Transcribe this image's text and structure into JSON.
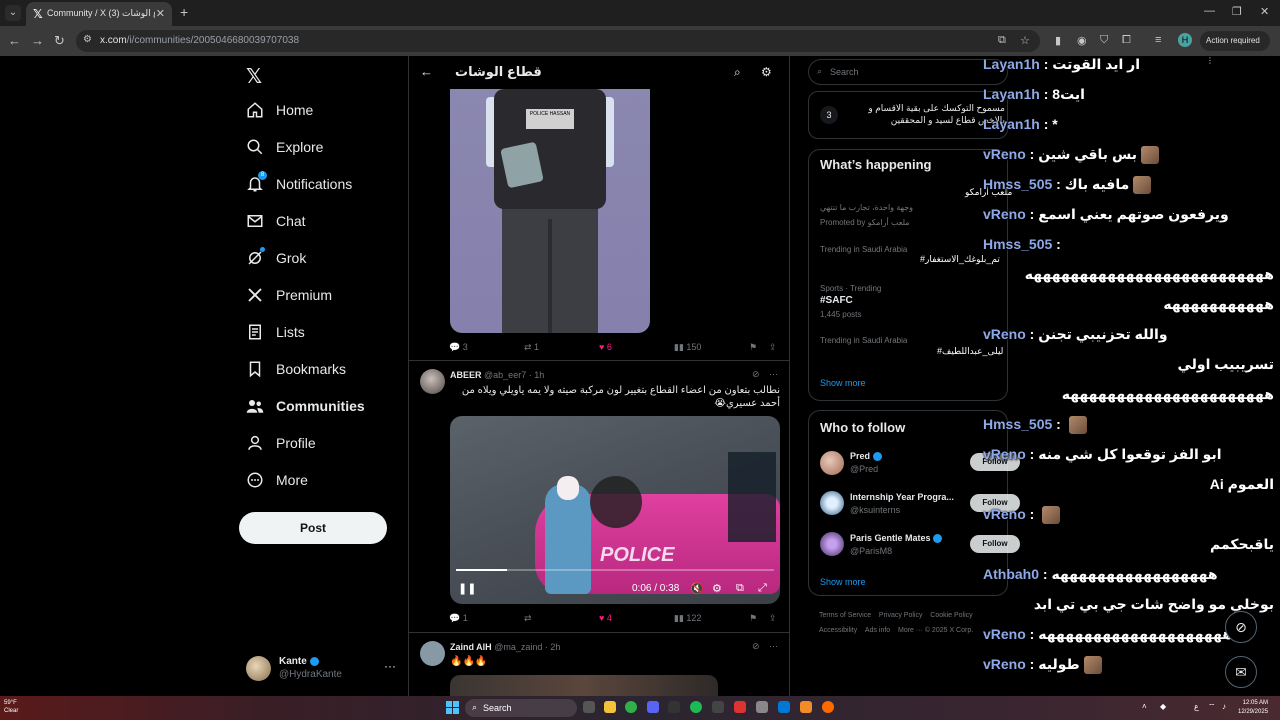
{
  "browser": {
    "tab_title": "Community / X قطاع الوشات (3)",
    "url_host": "x.com",
    "url_path": "/i/communities/2005046680039707038",
    "action_required": "Action required",
    "profile_initial": "H"
  },
  "nav": {
    "items": [
      {
        "label": "Home",
        "icon": "home-icon"
      },
      {
        "label": "Explore",
        "icon": "search-icon"
      },
      {
        "label": "Notifications",
        "icon": "bell-icon",
        "badge": "8"
      },
      {
        "label": "Chat",
        "icon": "mail-icon"
      },
      {
        "label": "Grok",
        "icon": "grok-icon"
      },
      {
        "label": "Premium",
        "icon": "x-icon"
      },
      {
        "label": "Lists",
        "icon": "list-icon"
      },
      {
        "label": "Bookmarks",
        "icon": "bookmark-icon"
      },
      {
        "label": "Communities",
        "icon": "people-icon"
      },
      {
        "label": "Profile",
        "icon": "person-icon"
      },
      {
        "label": "More",
        "icon": "more-circle-icon"
      }
    ],
    "post_label": "Post",
    "account": {
      "name": "Kante",
      "handle": "@HydraKante"
    }
  },
  "timeline": {
    "community_title": "قطاع الوشات",
    "post1": {
      "replies": "3",
      "reposts": "1",
      "likes": "6",
      "views": "150",
      "badge_text": "POLICE HASSAN"
    },
    "post2": {
      "name": "ABEER",
      "handle": "@ab_eer7 · 1h",
      "text": "نطالب بتعاون من اعضاء القطاع بتغيير لون مركبة صيته ولا يمه ياويلي ويلاه من أحمد عسيري😭",
      "video_time": "0:06 / 0:38",
      "video_progress": 0.16,
      "car_label": "POLICE",
      "replies": "1",
      "reposts": "",
      "likes": "4",
      "views": "122"
    },
    "post3": {
      "name": "Zaind AlH",
      "handle": "@ma_zaind · 2h",
      "text": "🔥🔥🔥"
    }
  },
  "right": {
    "search_placeholder": "Search",
    "rule": {
      "number": "3",
      "text": "مسموح التوكسك على بقية الاقسام و بالاخص قطاع لسيد و المحققين"
    },
    "whats_happening": "What’s happening",
    "ad": {
      "line1": "وجهة واحدة، تجارب ما تنتهي",
      "line2": "Promoted by ملعب أرامكو",
      "overlay": "ملعب أرامكو"
    },
    "trends": [
      {
        "context": "Trending in Saudi Arabia",
        "name": "#تم_بلوغك_الاستغفار",
        "posts": ""
      },
      {
        "context": "Sports · Trending",
        "name": "#SAFC",
        "posts": "1,445 posts"
      },
      {
        "context": "Trending in Saudi Arabia",
        "name": "#ليلى_عبداللطيف",
        "posts": ""
      }
    ],
    "show_more": "Show more",
    "who_to_follow": "Who to follow",
    "follow": [
      {
        "name": "Pred",
        "handle": "@Pred"
      },
      {
        "name": "Internship Year Progra...",
        "handle": "@ksuinterns"
      },
      {
        "name": "Paris Gentle Mates",
        "handle": "@ParisM8"
      }
    ],
    "follow_label": "Follow",
    "footer": {
      "l1": [
        "Terms of Service",
        "Privacy Policy",
        "Cookie Policy"
      ],
      "l2": [
        "Accessibility",
        "Ads info",
        "More ···",
        "© 2025 X Corp."
      ]
    }
  },
  "chat": [
    {
      "user": "Layan1h",
      "msg": "ار ايد القوتت"
    },
    {
      "user": "Layan1h",
      "msg": "ايت8"
    },
    {
      "user": "Layan1h",
      "msg": "*"
    },
    {
      "user": "vReno",
      "msg": "بس باقي شين",
      "emote": true
    },
    {
      "user": "Hmss_505",
      "msg": "مافيه باك",
      "emote": true
    },
    {
      "user": "vReno",
      "msg": "ويرفعون صوتهم يعني اسمع"
    },
    {
      "user": "Hmss_505",
      "msg": ""
    },
    {
      "user": "",
      "msg": "ههههههههههههههههههههههههههه"
    },
    {
      "user": "",
      "msg": "هههههههههههه"
    },
    {
      "user": "vReno",
      "msg": "والله تحزنيبي تجنن"
    },
    {
      "user": "",
      "msg": "تسريبيب اولي"
    },
    {
      "user": "",
      "msg": "ههههههههههههههههههههههه"
    },
    {
      "user": "Hmss_505",
      "msg": "",
      "emote": true
    },
    {
      "user": "vReno",
      "msg": "ابو الفز توقعوا كل شي منه"
    },
    {
      "user": "",
      "msg": "العموم Ai"
    },
    {
      "user": "vReno",
      "msg": "",
      "emote": true
    },
    {
      "user": "",
      "msg": "ياقبحكمم"
    },
    {
      "user": "Athbah0",
      "msg": "هههههههههههههههههه"
    },
    {
      "user": "",
      "msg": "بوخلي مو واضح شات جي بي تي ابد"
    },
    {
      "user": "vReno",
      "msg": "ههههههههههههههههههههه"
    },
    {
      "user": "vReno",
      "msg": "طوليه",
      "emote": true
    }
  ],
  "taskbar": {
    "weather_temp": "59°F",
    "weather_cond": "Clear",
    "search": "Search",
    "time": "12:05 AM",
    "date": "12/29/2025",
    "lang": "ع"
  }
}
